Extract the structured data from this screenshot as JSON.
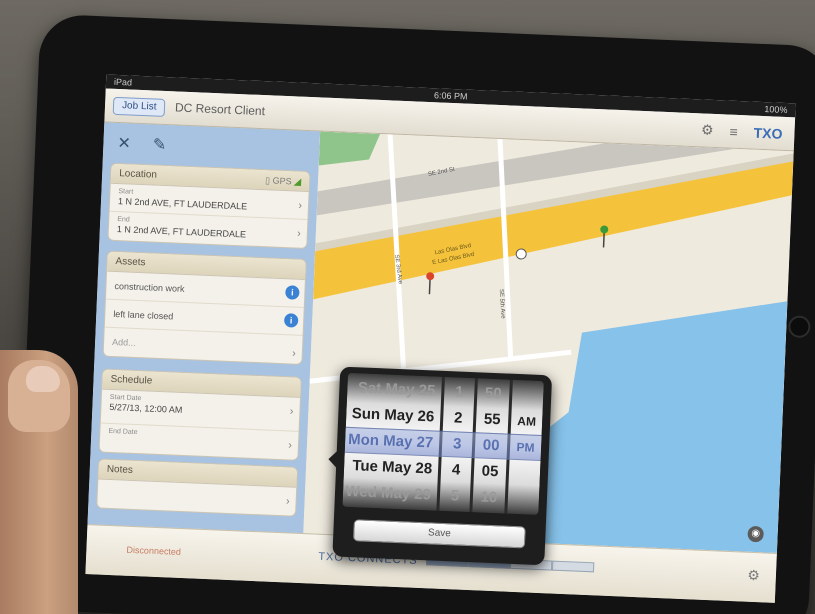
{
  "statusbar": {
    "carrier": "iPad",
    "time": "6:06 PM",
    "battery": "100%"
  },
  "header": {
    "back_label": "Job List",
    "title": "DC Resort Client",
    "brand": "TXO"
  },
  "panel": {
    "location": {
      "title": "Location",
      "badge": "GPS",
      "rows": [
        {
          "small": "Start",
          "value": "1 N 2nd AVE, FT LAUDERDALE"
        },
        {
          "small": "End",
          "value": "1 N 2nd AVE, FT LAUDERDALE"
        }
      ]
    },
    "assets": {
      "title": "Assets",
      "rows": [
        "construction work",
        "left lane closed",
        "Add..."
      ]
    },
    "schedule": {
      "title": "Schedule",
      "rows": [
        {
          "small": "Start Date",
          "value": "5/27/13, 12:00 AM"
        },
        {
          "small": "End Date",
          "value": ""
        }
      ]
    },
    "notes": {
      "title": "Notes"
    }
  },
  "map": {
    "roads": [
      "Las Olas Blvd",
      "E Las Olas Blvd",
      "SE 2nd St",
      "SE 3rd Ave",
      "SE 5th Ave"
    ]
  },
  "picker": {
    "dates": [
      "Sat May 25",
      "Sun May 26",
      "Mon May 27",
      "Tue May 28",
      "Wed May 29"
    ],
    "hours": [
      "1",
      "2",
      "3",
      "4",
      "5"
    ],
    "minutes": [
      "50",
      "55",
      "00",
      "05",
      "10"
    ],
    "ampm": [
      "AM",
      "PM"
    ],
    "save_label": "Save"
  },
  "footer": {
    "left": "Disconnected",
    "brand": "TXO CONNECTS"
  }
}
